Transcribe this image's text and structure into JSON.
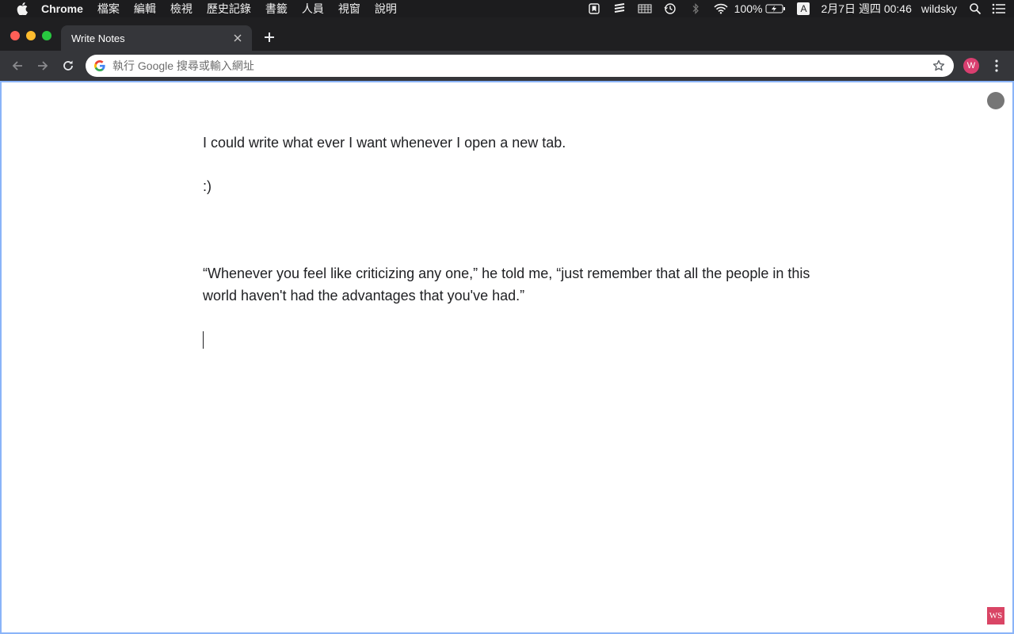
{
  "menubar": {
    "app_name": "Chrome",
    "items": [
      "檔案",
      "編輯",
      "檢視",
      "歷史記錄",
      "書籤",
      "人員",
      "視窗",
      "說明"
    ],
    "battery": "100%",
    "input_method": "A",
    "datetime": "2月7日 週四  00:46",
    "user": "wildsky"
  },
  "tab": {
    "title": "Write Notes"
  },
  "omnibox": {
    "placeholder": "執行 Google 搜尋或輸入網址",
    "value": ""
  },
  "profile": {
    "initial": "W",
    "color": "#d93f70"
  },
  "editor": {
    "paragraphs": [
      "I could write what ever I want whenever I open a new tab.",
      ":)",
      "",
      "“Whenever you feel like criticizing any one,” he told me, “just remember that all the people in this world haven't had the advantages that you've had.”"
    ]
  },
  "badge": {
    "label": "WS",
    "color": "#d94565"
  },
  "icons": {
    "apple": "apple-icon",
    "back": "back-arrow-icon",
    "forward": "forward-arrow-icon",
    "reload": "reload-icon",
    "google": "google-g-icon",
    "star": "bookmark-star-icon",
    "menu": "kebab-menu-icon"
  }
}
